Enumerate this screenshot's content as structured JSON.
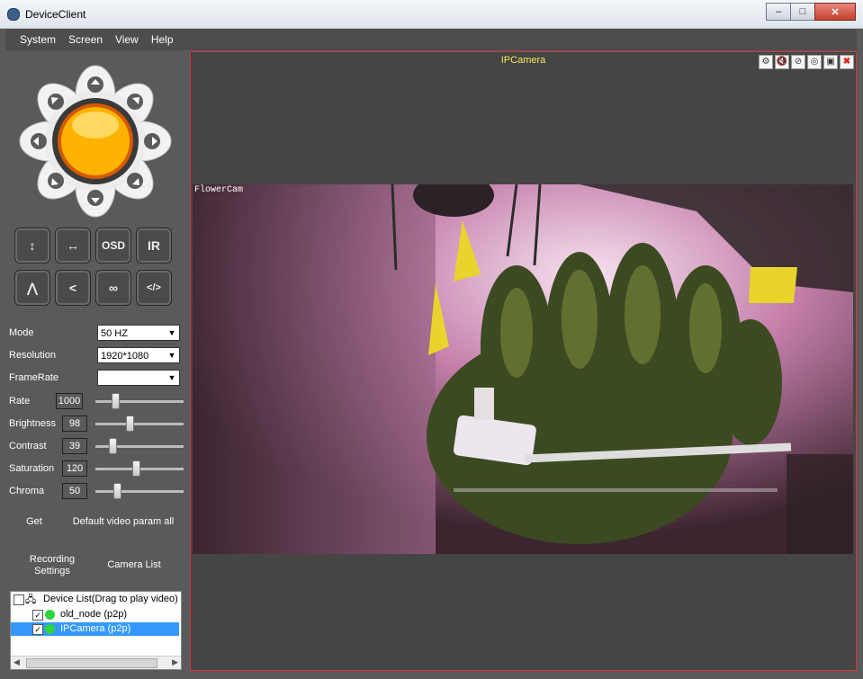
{
  "window": {
    "title": "DeviceClient",
    "buttons": [
      "minimize",
      "maximize",
      "close"
    ]
  },
  "menu": [
    "System",
    "Screen",
    "View",
    "Help"
  ],
  "ptz": {
    "directions": [
      "up",
      "up-right",
      "right",
      "down-right",
      "down",
      "down-left",
      "left",
      "up-left"
    ]
  },
  "func_buttons": [
    {
      "name": "flip-vertical",
      "label": "↕"
    },
    {
      "name": "flip-horizontal",
      "label": "↔"
    },
    {
      "name": "osd",
      "label": "OSD"
    },
    {
      "name": "ir",
      "label": "IR"
    },
    {
      "name": "cruise-vertical",
      "label": "⋀"
    },
    {
      "name": "cruise-horizontal",
      "label": "<"
    },
    {
      "name": "cruise-loop",
      "label": "∞"
    },
    {
      "name": "code",
      "label": "</>"
    }
  ],
  "settings": {
    "mode": {
      "label": "Mode",
      "value": "50 HZ"
    },
    "resolution": {
      "label": "Resolution",
      "value": "1920*1080"
    },
    "framerate": {
      "label": "FrameRate",
      "value": ""
    },
    "sliders": [
      {
        "label": "Rate",
        "value": "1000",
        "level": 0.2
      },
      {
        "label": "Brightness",
        "value": "98",
        "level": 0.38
      },
      {
        "label": "Contrast",
        "value": "39",
        "level": 0.17
      },
      {
        "label": "Saturation",
        "value": "120",
        "level": 0.46
      },
      {
        "label": "Chroma",
        "value": "50",
        "level": 0.22
      }
    ]
  },
  "actions": {
    "get": "Get",
    "default": "Default video param all",
    "recording": "Recording Settings",
    "camera_list": "Camera List"
  },
  "device_tree": {
    "root": "Device List(Drag to play video)",
    "items": [
      {
        "name": "old_node (p2p)",
        "checked": true,
        "online": true,
        "selected": false
      },
      {
        "name": "IPCamera (p2p)",
        "checked": true,
        "online": true,
        "selected": true
      }
    ]
  },
  "video": {
    "title": "IPCamera",
    "overlay": "FlowerCam"
  },
  "colors": {
    "accent": "#3399ff",
    "title_text": "#f3e85b",
    "border": "#dd3333",
    "online": "#31d33b"
  }
}
